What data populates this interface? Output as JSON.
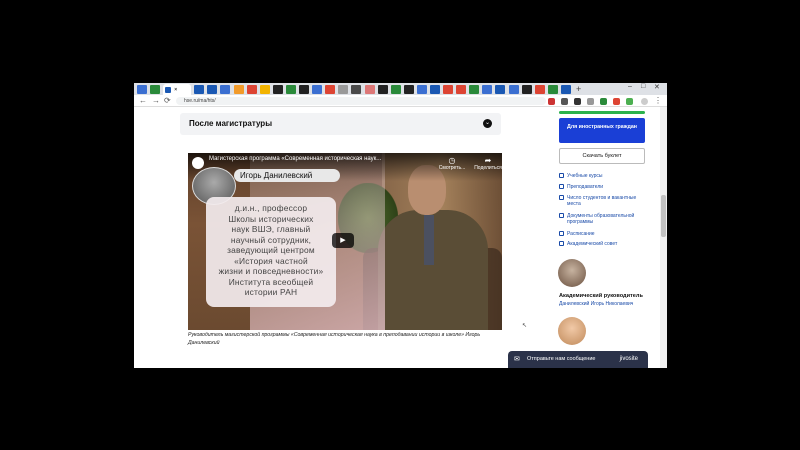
{
  "browser": {
    "tabs": [
      "",
      "",
      "",
      "",
      "",
      "",
      "",
      "",
      "",
      "",
      "",
      "",
      "",
      "",
      "",
      "",
      "",
      "",
      "",
      "",
      "",
      "",
      "",
      "",
      "",
      "",
      "",
      "",
      "",
      "",
      "",
      ""
    ],
    "active_tab_close": "×",
    "new_tab": "+",
    "window_controls": [
      "–",
      "□",
      "✕"
    ],
    "back": "←",
    "forward": "→",
    "reload": "⟳",
    "url": "hse.ru/ma/hts/"
  },
  "page": {
    "accordion_title": "После магистратуры",
    "accordion_chevron": "⌄",
    "video": {
      "title": "Магистерская программа «Современная историческая наук...",
      "watch_later": "Смотреть...",
      "share": "Поделиться",
      "name": "Игорь Данилевский",
      "caption_lines": [
        "д.и.н., профессор",
        "Школы исторических",
        "наук ВШЭ, главный",
        "научный сотрудник,",
        "заведующий центром",
        "«История частной",
        "жизни и повседневности»",
        "Института всеобщей",
        "истории РАН"
      ],
      "play": "▶"
    },
    "video_caption": "Руководитель магистерской программы «Современная историческая наука в преподавании истории в школе» Игорь Данилевский"
  },
  "sidebar": {
    "foreign_button": "Для иностранных граждан",
    "booklet_button": "Скачать буклет",
    "links": [
      "Учебные курсы",
      "Преподаватели",
      "Число студентов и вакантные места",
      "Документы образовательной программы",
      "Расписание",
      "Академический совет"
    ],
    "academic_head_title": "Академический руководитель",
    "academic_head_name": "Данилевский Игорь Николаевич"
  },
  "chat": {
    "label": "Отправьте нам сообщение",
    "brand": "jivosite"
  },
  "colors": {
    "accent_blue": "#1a3fd6",
    "link_blue": "#1a4ba8",
    "green": "#2bb24c",
    "chat_bg": "#2b3249"
  }
}
